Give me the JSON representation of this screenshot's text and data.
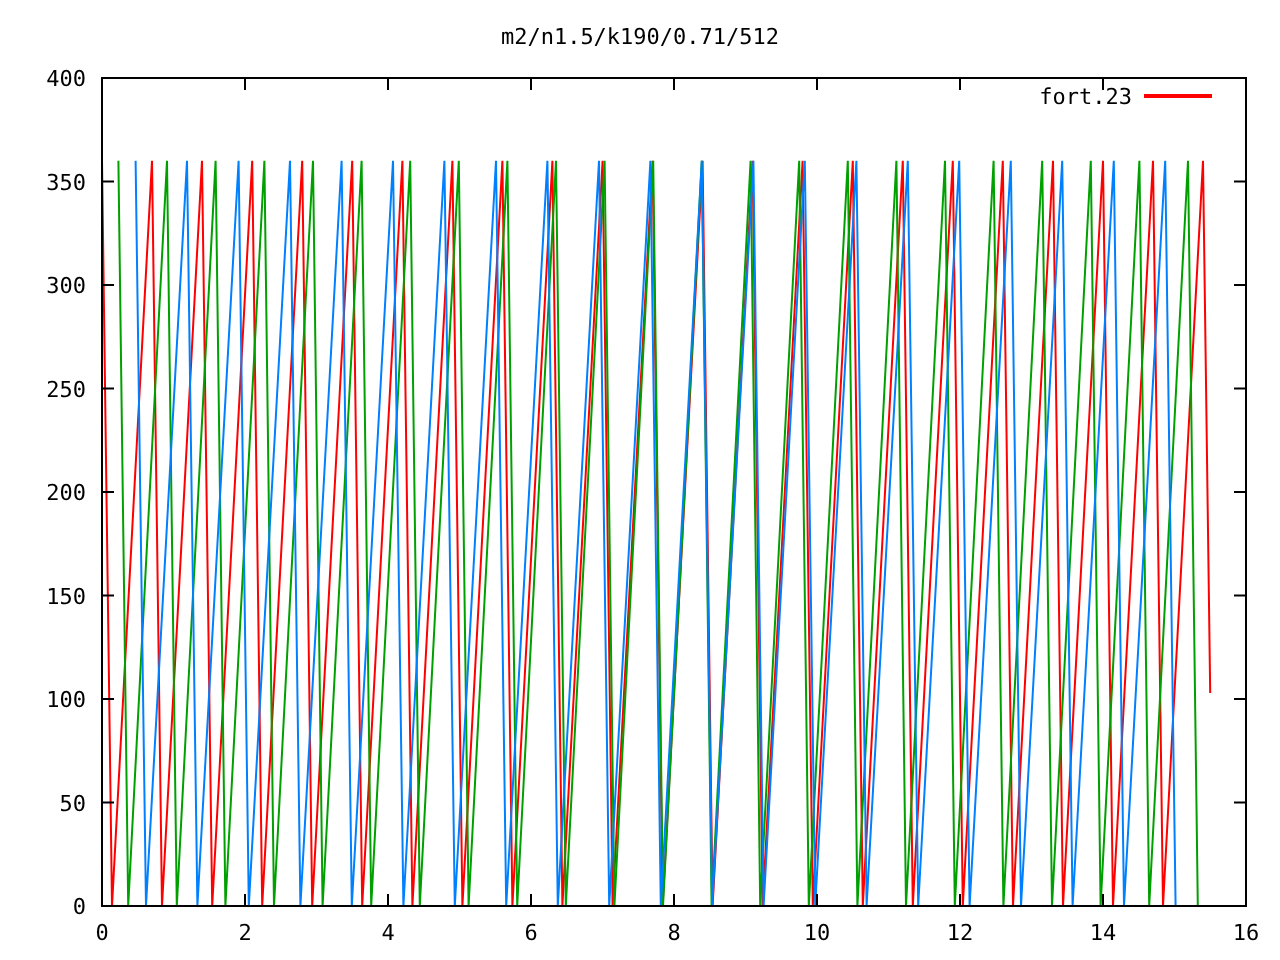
{
  "plot": {
    "title": "m2/n1.5/k190/0.71/512",
    "legend": [
      {
        "label": "fort.23",
        "color": "#ff0000"
      }
    ],
    "x_tick_labels": [
      "0",
      "2",
      "4",
      "6",
      "8",
      "10",
      "12",
      "14",
      "16"
    ],
    "y_tick_labels": [
      "400",
      "350",
      "300",
      "250",
      "200",
      "150",
      "100",
      "50",
      "0"
    ]
  }
}
